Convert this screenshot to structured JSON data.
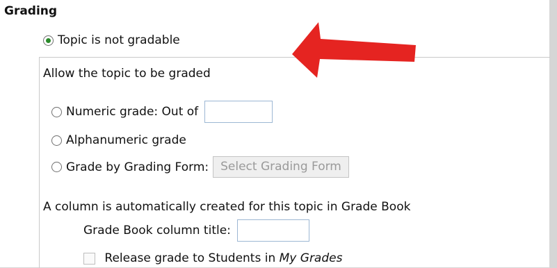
{
  "section": {
    "title": "Grading"
  },
  "options": {
    "not_gradable_label": "Topic is not gradable",
    "allow_graded_label": "Allow the topic to be graded",
    "numeric_label": "Numeric grade: Out of",
    "alphanumeric_label": "Alphanumeric grade",
    "form_label": "Grade by Grading Form:",
    "select_form_button": "Select Grading Form"
  },
  "gradebook": {
    "note": "A column is automatically created for this topic in Grade Book",
    "column_title_label": "Grade Book column title:",
    "release_label_prefix": "Release grade to Students in ",
    "release_label_em": "My Grades"
  },
  "colors": {
    "annotation_arrow": "#e52421",
    "radio_selected": "#2a8a2a",
    "input_border": "#9cb7d3"
  },
  "icons": {
    "annotation": "red-arrow-icon"
  }
}
